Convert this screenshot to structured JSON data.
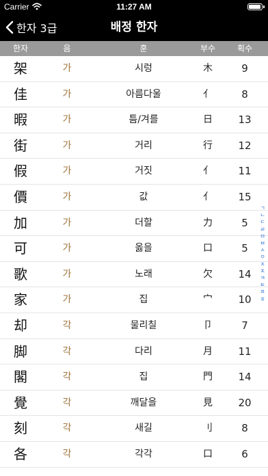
{
  "status_bar": {
    "carrier": "Carrier",
    "time": "11:27 AM",
    "battery_level": 0.95
  },
  "nav": {
    "back_label": "한자 3급",
    "title": "배정 한자"
  },
  "columns": {
    "hanja": "한자",
    "eum": "음",
    "hun": "훈",
    "busu": "부수",
    "hoesu": "획수"
  },
  "rows": [
    {
      "hanja": "架",
      "eum": "가",
      "hun": "시렁",
      "busu": "木",
      "hoesu": "9"
    },
    {
      "hanja": "佳",
      "eum": "가",
      "hun": "아름다울",
      "busu": "亻",
      "hoesu": "8"
    },
    {
      "hanja": "暇",
      "eum": "가",
      "hun": "틈/겨를",
      "busu": "日",
      "hoesu": "13"
    },
    {
      "hanja": "街",
      "eum": "가",
      "hun": "거리",
      "busu": "行",
      "hoesu": "12"
    },
    {
      "hanja": "假",
      "eum": "가",
      "hun": "거짓",
      "busu": "亻",
      "hoesu": "11"
    },
    {
      "hanja": "價",
      "eum": "가",
      "hun": "값",
      "busu": "亻",
      "hoesu": "15"
    },
    {
      "hanja": "加",
      "eum": "가",
      "hun": "더할",
      "busu": "力",
      "hoesu": "5"
    },
    {
      "hanja": "可",
      "eum": "가",
      "hun": "옳을",
      "busu": "口",
      "hoesu": "5"
    },
    {
      "hanja": "歌",
      "eum": "가",
      "hun": "노래",
      "busu": "欠",
      "hoesu": "14"
    },
    {
      "hanja": "家",
      "eum": "가",
      "hun": "집",
      "busu": "宀",
      "hoesu": "10"
    },
    {
      "hanja": "却",
      "eum": "각",
      "hun": "물리칠",
      "busu": "卩",
      "hoesu": "7"
    },
    {
      "hanja": "脚",
      "eum": "각",
      "hun": "다리",
      "busu": "月",
      "hoesu": "11"
    },
    {
      "hanja": "閣",
      "eum": "각",
      "hun": "집",
      "busu": "門",
      "hoesu": "14"
    },
    {
      "hanja": "覺",
      "eum": "각",
      "hun": "깨달을",
      "busu": "見",
      "hoesu": "20"
    },
    {
      "hanja": "刻",
      "eum": "각",
      "hun": "새길",
      "busu": "刂",
      "hoesu": "8"
    },
    {
      "hanja": "各",
      "eum": "각",
      "hun": "각각",
      "busu": "口",
      "hoesu": "6"
    }
  ],
  "index": [
    "ㄱ",
    "ㄴ",
    "ㄷ",
    "ㄹ",
    "ㅁ",
    "ㅂ",
    "ㅅ",
    "ㅇ",
    "ㅈ",
    "ㅊ",
    "ㅋ",
    "ㅌ",
    "ㅍ",
    "ㅎ"
  ],
  "colors": {
    "bar_background": "#000000",
    "header_background": "#9a9a9a",
    "eum_text": "#a0753c",
    "index_text": "#2a6fd6"
  }
}
